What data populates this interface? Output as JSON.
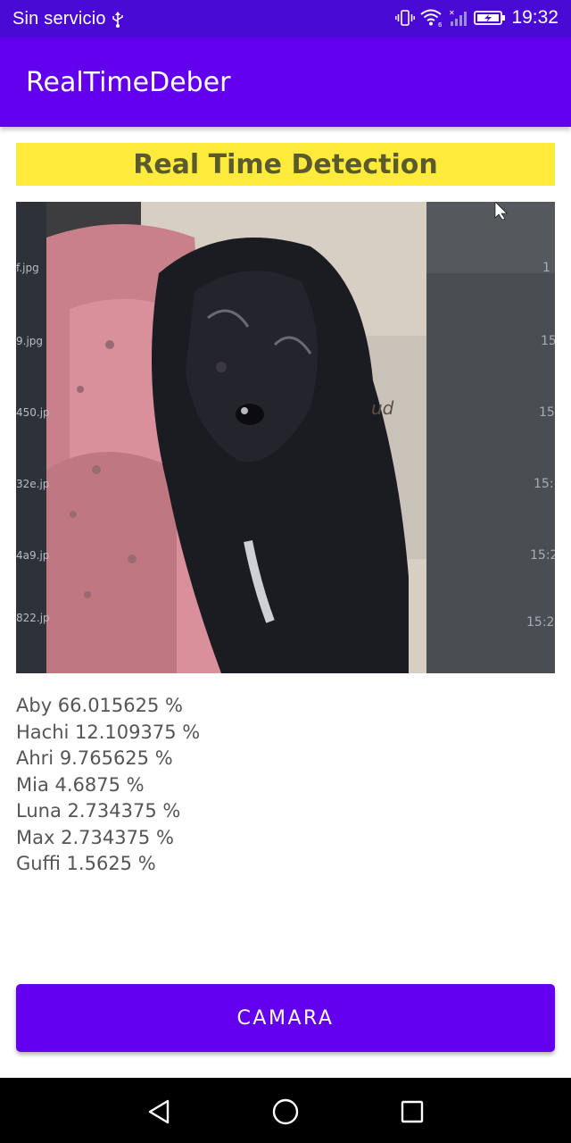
{
  "status_bar": {
    "carrier": "Sin servicio",
    "time": "19:32",
    "icons": [
      "usb-icon",
      "vibrate-icon",
      "wifi-icon",
      "signal-icon",
      "battery-charging-icon"
    ]
  },
  "app_bar": {
    "title": "RealTimeDeber"
  },
  "banner": {
    "text": "Real Time Detection",
    "color": "#ffeb3b"
  },
  "preview": {
    "description_icon": "camera-preview-image"
  },
  "results": [
    "Aby 66.015625 %",
    "Hachi 12.109375 %",
    "Ahri 9.765625 %",
    "Mia 4.6875 %",
    "Luna 2.734375 %",
    "Max 2.734375 %",
    "Guffi 1.5625 %"
  ],
  "button": {
    "label": "CAMARA"
  },
  "nav_bar": {
    "icons": [
      "back-icon",
      "home-icon",
      "recents-icon"
    ]
  },
  "colors": {
    "status_bar": "#4a0ad6",
    "app_bar": "#6200ee",
    "accent": "#6200ee",
    "banner": "#ffeb3b",
    "result_text": "#555555"
  }
}
